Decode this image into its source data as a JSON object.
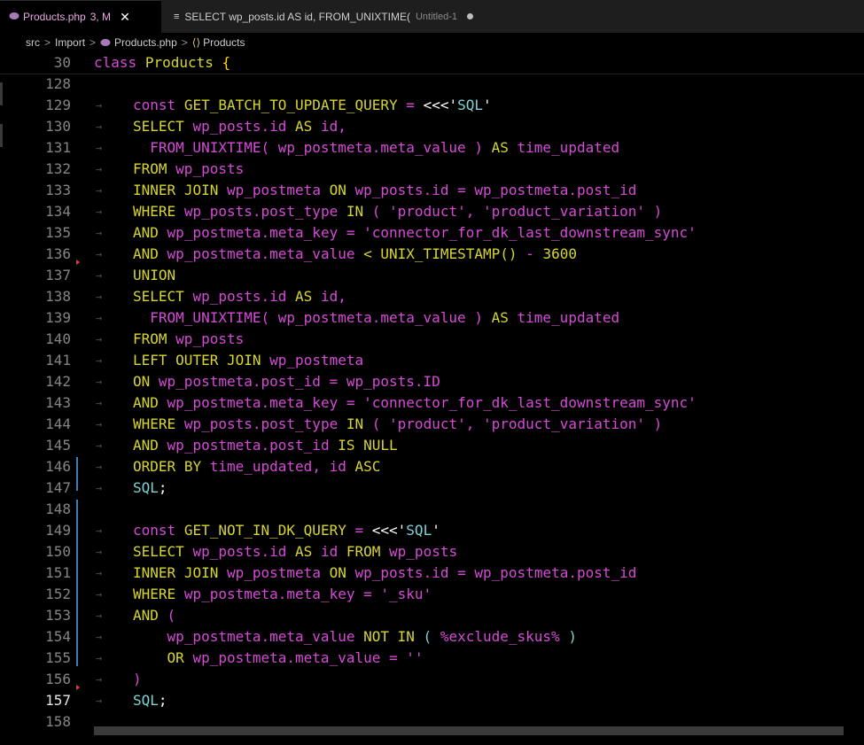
{
  "tabs": [
    {
      "name": "Products.php",
      "badge": "3, M",
      "close": "✕",
      "icon": "php-elephant-icon",
      "active": true
    },
    {
      "name": "SELECT wp_posts.id AS id, FROM_UNIXTIME(",
      "sub": "Untitled-1",
      "icon": "sql-icon",
      "dirty": true
    }
  ],
  "breadcrumb": {
    "parts": [
      "src",
      "Import",
      "Products.php",
      "Products"
    ],
    "sep": ">"
  },
  "sticky": {
    "line": "30",
    "code": [
      [
        "kw",
        "class"
      ],
      [
        "sp",
        " "
      ],
      [
        "cls",
        "Products"
      ],
      [
        "sp",
        " "
      ],
      [
        "brace",
        "{"
      ]
    ]
  },
  "lines": [
    {
      "n": "128",
      "code": []
    },
    {
      "n": "129",
      "code": [
        [
          "kw",
          "const"
        ],
        [
          "sp",
          " "
        ],
        [
          "nm",
          "GET_BATCH_TO_UPDATE_QUERY"
        ],
        [
          "sp",
          " "
        ],
        [
          "op",
          "="
        ],
        [
          "sp",
          " "
        ],
        [
          "strg",
          "<<<'"
        ],
        [
          "cons",
          "SQL"
        ],
        [
          "strg",
          "'"
        ]
      ]
    },
    {
      "n": "130",
      "code": [
        [
          "nm",
          "SELECT"
        ],
        [
          "sp",
          " "
        ],
        [
          "kw",
          "wp_posts.id"
        ],
        [
          "sp",
          " "
        ],
        [
          "nm",
          "AS"
        ],
        [
          "sp",
          " "
        ],
        [
          "kw",
          "id,"
        ]
      ]
    },
    {
      "n": "131",
      "code": [
        [
          "sp",
          "  "
        ],
        [
          "kw",
          "FROM_UNIXTIME("
        ],
        [
          "sp",
          " "
        ],
        [
          "kw",
          "wp_postmeta.meta_value"
        ],
        [
          "sp",
          " "
        ],
        [
          "kw",
          ")"
        ],
        [
          "sp",
          " "
        ],
        [
          "nm",
          "AS"
        ],
        [
          "sp",
          " "
        ],
        [
          "kw",
          "time_updated"
        ]
      ]
    },
    {
      "n": "132",
      "code": [
        [
          "nm",
          "FROM"
        ],
        [
          "sp",
          " "
        ],
        [
          "kw",
          "wp_posts"
        ]
      ]
    },
    {
      "n": "133",
      "code": [
        [
          "nm",
          "INNER"
        ],
        [
          "sp",
          " "
        ],
        [
          "nm",
          "JOIN"
        ],
        [
          "sp",
          " "
        ],
        [
          "kw",
          "wp_postmeta"
        ],
        [
          "sp",
          " "
        ],
        [
          "nm",
          "ON"
        ],
        [
          "sp",
          " "
        ],
        [
          "kw",
          "wp_posts.id"
        ],
        [
          "sp",
          " "
        ],
        [
          "kw",
          "="
        ],
        [
          "sp",
          " "
        ],
        [
          "kw",
          "wp_postmeta.post_id"
        ]
      ]
    },
    {
      "n": "134",
      "code": [
        [
          "nm",
          "WHERE"
        ],
        [
          "sp",
          " "
        ],
        [
          "kw",
          "wp_posts.post_type"
        ],
        [
          "sp",
          " "
        ],
        [
          "nm",
          "IN"
        ],
        [
          "sp",
          " "
        ],
        [
          "kw",
          "("
        ],
        [
          "sp",
          " "
        ],
        [
          "kw",
          "'product',"
        ],
        [
          "sp",
          " "
        ],
        [
          "kw",
          "'product_variation'"
        ],
        [
          "sp",
          " "
        ],
        [
          "kw",
          ")"
        ]
      ]
    },
    {
      "n": "135",
      "code": [
        [
          "nm",
          "AND"
        ],
        [
          "sp",
          " "
        ],
        [
          "kw",
          "wp_postmeta.meta_key"
        ],
        [
          "sp",
          " "
        ],
        [
          "kw",
          "="
        ],
        [
          "sp",
          " "
        ],
        [
          "kw",
          "'connector_for_dk_last_downstream_sync'"
        ]
      ]
    },
    {
      "n": "136",
      "code": [
        [
          "nm",
          "AND"
        ],
        [
          "sp",
          " "
        ],
        [
          "kw",
          "wp_postmeta.meta_value"
        ],
        [
          "sp",
          " "
        ],
        [
          "nm",
          "<"
        ],
        [
          "sp",
          " "
        ],
        [
          "nm",
          "UNIX_TIMESTAMP()"
        ],
        [
          "sp",
          " "
        ],
        [
          "kw",
          "-"
        ],
        [
          "sp",
          " "
        ],
        [
          "nm",
          "3600"
        ]
      ]
    },
    {
      "n": "137",
      "code": [
        [
          "nm",
          "UNION"
        ]
      ]
    },
    {
      "n": "138",
      "code": [
        [
          "nm",
          "SELECT"
        ],
        [
          "sp",
          " "
        ],
        [
          "kw",
          "wp_posts.id"
        ],
        [
          "sp",
          " "
        ],
        [
          "nm",
          "AS"
        ],
        [
          "sp",
          " "
        ],
        [
          "kw",
          "id,"
        ]
      ]
    },
    {
      "n": "139",
      "code": [
        [
          "sp",
          "  "
        ],
        [
          "kw",
          "FROM_UNIXTIME("
        ],
        [
          "sp",
          " "
        ],
        [
          "kw",
          "wp_postmeta.meta_value"
        ],
        [
          "sp",
          " "
        ],
        [
          "kw",
          ")"
        ],
        [
          "sp",
          " "
        ],
        [
          "nm",
          "AS"
        ],
        [
          "sp",
          " "
        ],
        [
          "kw",
          "time_updated"
        ]
      ]
    },
    {
      "n": "140",
      "code": [
        [
          "nm",
          "FROM"
        ],
        [
          "sp",
          " "
        ],
        [
          "kw",
          "wp_posts"
        ]
      ]
    },
    {
      "n": "141",
      "code": [
        [
          "nm",
          "LEFT"
        ],
        [
          "sp",
          " "
        ],
        [
          "nm",
          "OUTER"
        ],
        [
          "sp",
          " "
        ],
        [
          "nm",
          "JOIN"
        ],
        [
          "sp",
          " "
        ],
        [
          "kw",
          "wp_postmeta"
        ]
      ]
    },
    {
      "n": "142",
      "code": [
        [
          "nm",
          "ON"
        ],
        [
          "sp",
          " "
        ],
        [
          "kw",
          "wp_postmeta.post_id"
        ],
        [
          "sp",
          " "
        ],
        [
          "kw",
          "="
        ],
        [
          "sp",
          " "
        ],
        [
          "kw",
          "wp_posts.ID"
        ]
      ]
    },
    {
      "n": "143",
      "code": [
        [
          "nm",
          "AND"
        ],
        [
          "sp",
          " "
        ],
        [
          "kw",
          "wp_postmeta.meta_key"
        ],
        [
          "sp",
          " "
        ],
        [
          "kw",
          "="
        ],
        [
          "sp",
          " "
        ],
        [
          "kw",
          "'connector_for_dk_last_downstream_sync'"
        ]
      ]
    },
    {
      "n": "144",
      "code": [
        [
          "nm",
          "WHERE"
        ],
        [
          "sp",
          " "
        ],
        [
          "kw",
          "wp_posts.post_type"
        ],
        [
          "sp",
          " "
        ],
        [
          "nm",
          "IN"
        ],
        [
          "sp",
          " "
        ],
        [
          "kw",
          "("
        ],
        [
          "sp",
          " "
        ],
        [
          "kw",
          "'product',"
        ],
        [
          "sp",
          " "
        ],
        [
          "kw",
          "'product_variation'"
        ],
        [
          "sp",
          " "
        ],
        [
          "kw",
          ")"
        ]
      ]
    },
    {
      "n": "145",
      "code": [
        [
          "nm",
          "AND"
        ],
        [
          "sp",
          " "
        ],
        [
          "kw",
          "wp_postmeta.post_id"
        ],
        [
          "sp",
          " "
        ],
        [
          "nm",
          "IS"
        ],
        [
          "sp",
          " "
        ],
        [
          "nm",
          "NULL"
        ]
      ]
    },
    {
      "n": "146",
      "code": [
        [
          "nm",
          "ORDER"
        ],
        [
          "sp",
          " "
        ],
        [
          "nm",
          "BY"
        ],
        [
          "sp",
          " "
        ],
        [
          "kw",
          "time_updated,"
        ],
        [
          "sp",
          " "
        ],
        [
          "kw",
          "id"
        ],
        [
          "sp",
          " "
        ],
        [
          "nm",
          "ASC"
        ]
      ]
    },
    {
      "n": "147",
      "code": [
        [
          "cons",
          "SQL"
        ],
        [
          "strg",
          ";"
        ]
      ]
    },
    {
      "n": "148",
      "code": []
    },
    {
      "n": "149",
      "code": [
        [
          "kw",
          "const"
        ],
        [
          "sp",
          " "
        ],
        [
          "nm",
          "GET_NOT_IN_DK_QUERY"
        ],
        [
          "sp",
          " "
        ],
        [
          "op",
          "="
        ],
        [
          "sp",
          " "
        ],
        [
          "strg",
          "<<<'"
        ],
        [
          "cons",
          "SQL"
        ],
        [
          "strg",
          "'"
        ]
      ]
    },
    {
      "n": "150",
      "code": [
        [
          "nm",
          "SELECT"
        ],
        [
          "sp",
          " "
        ],
        [
          "kw",
          "wp_posts.id"
        ],
        [
          "sp",
          " "
        ],
        [
          "nm",
          "AS"
        ],
        [
          "sp",
          " "
        ],
        [
          "kw",
          "id"
        ],
        [
          "sp",
          " "
        ],
        [
          "nm",
          "FROM"
        ],
        [
          "sp",
          " "
        ],
        [
          "kw",
          "wp_posts"
        ]
      ]
    },
    {
      "n": "151",
      "code": [
        [
          "nm",
          "INNER"
        ],
        [
          "sp",
          " "
        ],
        [
          "nm",
          "JOIN"
        ],
        [
          "sp",
          " "
        ],
        [
          "kw",
          "wp_postmeta"
        ],
        [
          "sp",
          " "
        ],
        [
          "nm",
          "ON"
        ],
        [
          "sp",
          " "
        ],
        [
          "kw",
          "wp_posts.id"
        ],
        [
          "sp",
          " "
        ],
        [
          "kw",
          "="
        ],
        [
          "sp",
          " "
        ],
        [
          "kw",
          "wp_postmeta.post_id"
        ]
      ]
    },
    {
      "n": "152",
      "code": [
        [
          "nm",
          "WHERE"
        ],
        [
          "sp",
          " "
        ],
        [
          "kw",
          "wp_postmeta.meta_key"
        ],
        [
          "sp",
          " "
        ],
        [
          "kw",
          "="
        ],
        [
          "sp",
          " "
        ],
        [
          "kw",
          "'_sku'"
        ]
      ]
    },
    {
      "n": "153",
      "code": [
        [
          "nm",
          "AND"
        ],
        [
          "sp",
          " "
        ],
        [
          "kw",
          "("
        ]
      ]
    },
    {
      "n": "154",
      "code": [
        [
          "sp",
          "    "
        ],
        [
          "kw",
          "wp_postmeta.meta_value"
        ],
        [
          "sp",
          " "
        ],
        [
          "nm",
          "NOT"
        ],
        [
          "sp",
          " "
        ],
        [
          "nm",
          "IN"
        ],
        [
          "sp",
          " "
        ],
        [
          "cons",
          "("
        ],
        [
          "sp",
          " "
        ],
        [
          "kw",
          "%exclude_skus%"
        ],
        [
          "sp",
          " "
        ],
        [
          "cons",
          ")"
        ]
      ]
    },
    {
      "n": "155",
      "code": [
        [
          "sp",
          "    "
        ],
        [
          "nm",
          "OR"
        ],
        [
          "sp",
          " "
        ],
        [
          "kw",
          "wp_postmeta.meta_value"
        ],
        [
          "sp",
          " "
        ],
        [
          "kw",
          "="
        ],
        [
          "sp",
          " "
        ],
        [
          "kw",
          "''"
        ]
      ]
    },
    {
      "n": "156",
      "code": [
        [
          "kw",
          ")"
        ]
      ]
    },
    {
      "n": "157",
      "code": [
        [
          "cons",
          "SQL"
        ],
        [
          "strg",
          ";"
        ]
      ],
      "current": true
    },
    {
      "n": "158",
      "code": []
    }
  ],
  "colors": {
    "background": "#000000",
    "keyword": "#d54bd6",
    "identifier": "#d7d52e",
    "constant": "#7bd4d8"
  }
}
